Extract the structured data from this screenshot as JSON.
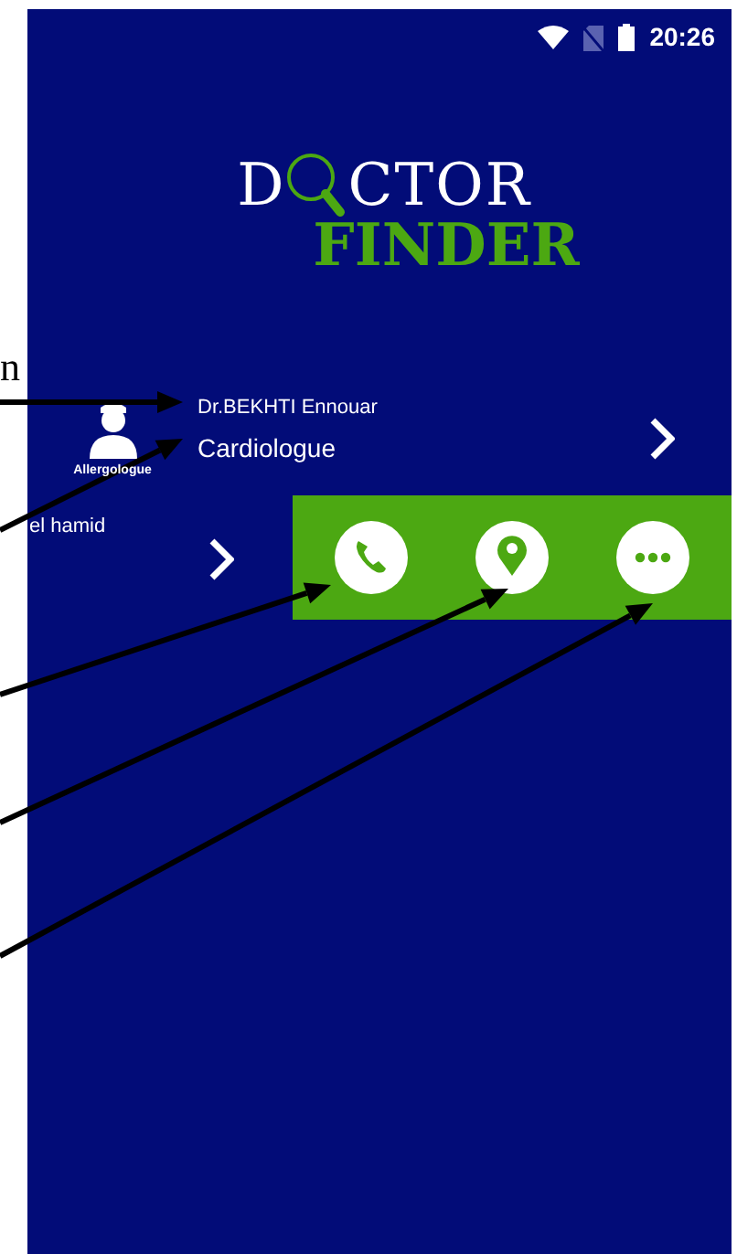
{
  "annotation_text": "n",
  "status_bar": {
    "time": "20:26"
  },
  "logo": {
    "first_letter": "D",
    "rest": "CTOR",
    "second_word": "FINDER"
  },
  "doctors": [
    {
      "name": "Dr.BEKHTI Ennouar",
      "specialty": "Cardiologue",
      "avatar_label": "Allergologue",
      "swiped": false
    },
    {
      "name": "el hamid",
      "swiped": true
    }
  ],
  "actions": [
    {
      "kind": "call"
    },
    {
      "kind": "location"
    },
    {
      "kind": "more"
    }
  ]
}
